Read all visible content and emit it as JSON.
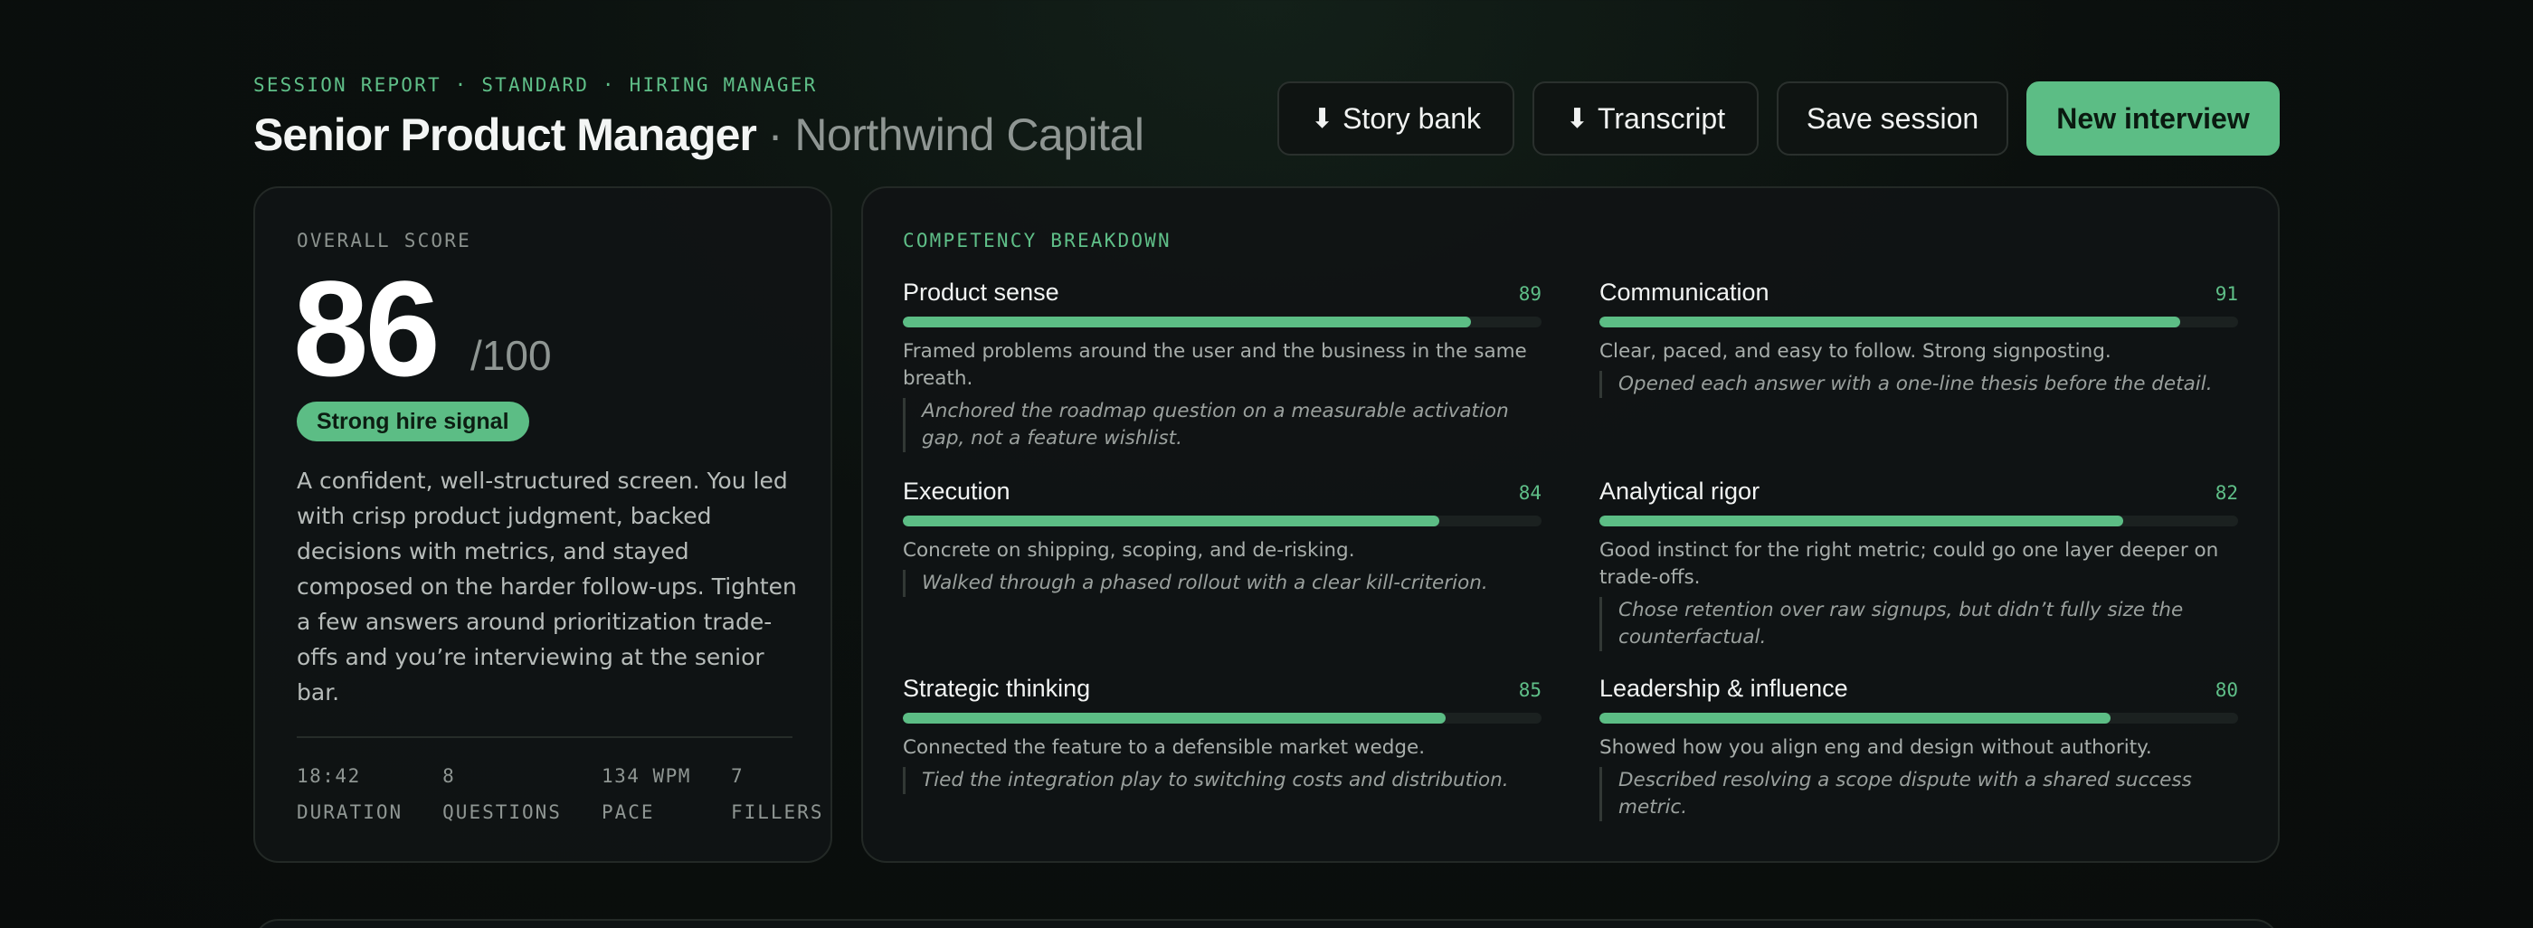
{
  "header": {
    "eyebrow": "SESSION REPORT · STANDARD · HIRING MANAGER",
    "role": "Senior Product Manager",
    "company": "· Northwind Capital"
  },
  "actions": {
    "story_bank": "Story bank",
    "transcript": "Transcript",
    "save": "Save session",
    "new_interview": "New interview",
    "download_icon": "⬇"
  },
  "score": {
    "label": "OVERALL SCORE",
    "value": "86",
    "max": "/100",
    "badge": "Strong hire signal",
    "summary": "A confident, well-structured screen. You led with crisp product judgment, backed decisions with metrics, and stayed composed on the harder follow-ups. Tighten a few answers around prioritization trade-offs and you’re interviewing at the senior bar.",
    "stats": [
      {
        "value": "18:42",
        "label": "DURATION"
      },
      {
        "value": "8",
        "label": "QUESTIONS"
      },
      {
        "value": "134 WPM",
        "label": "PACE"
      },
      {
        "value": "7",
        "label": "FILLERS"
      }
    ]
  },
  "competency": {
    "label": "COMPETENCY BREAKDOWN",
    "items": [
      {
        "name": "Product sense",
        "score": 89,
        "desc": "Framed problems around the user and the business in the same breath.",
        "quote": "Anchored the roadmap question on a measurable activation gap, not a feature wishlist."
      },
      {
        "name": "Communication",
        "score": 91,
        "desc": "Clear, paced, and easy to follow. Strong signposting.",
        "quote": "Opened each answer with a one-line thesis before the detail."
      },
      {
        "name": "Execution",
        "score": 84,
        "desc": "Concrete on shipping, scoping, and de-risking.",
        "quote": "Walked through a phased rollout with a clear kill-criterion."
      },
      {
        "name": "Analytical rigor",
        "score": 82,
        "desc": "Good instinct for the right metric; could go one layer deeper on trade-offs.",
        "quote": "Chose retention over raw signups, but didn’t fully size the counterfactual."
      },
      {
        "name": "Strategic thinking",
        "score": 85,
        "desc": "Connected the feature to a defensible market wedge.",
        "quote": "Tied the integration play to switching costs and distribution."
      },
      {
        "name": "Leadership & influence",
        "score": 80,
        "desc": "Showed how you align eng and design without authority.",
        "quote": "Described resolving a scope dispute with a shared success metric."
      }
    ]
  },
  "colors": {
    "accent": "#5cbd85",
    "background": "#0b100e",
    "card": "#101415"
  }
}
